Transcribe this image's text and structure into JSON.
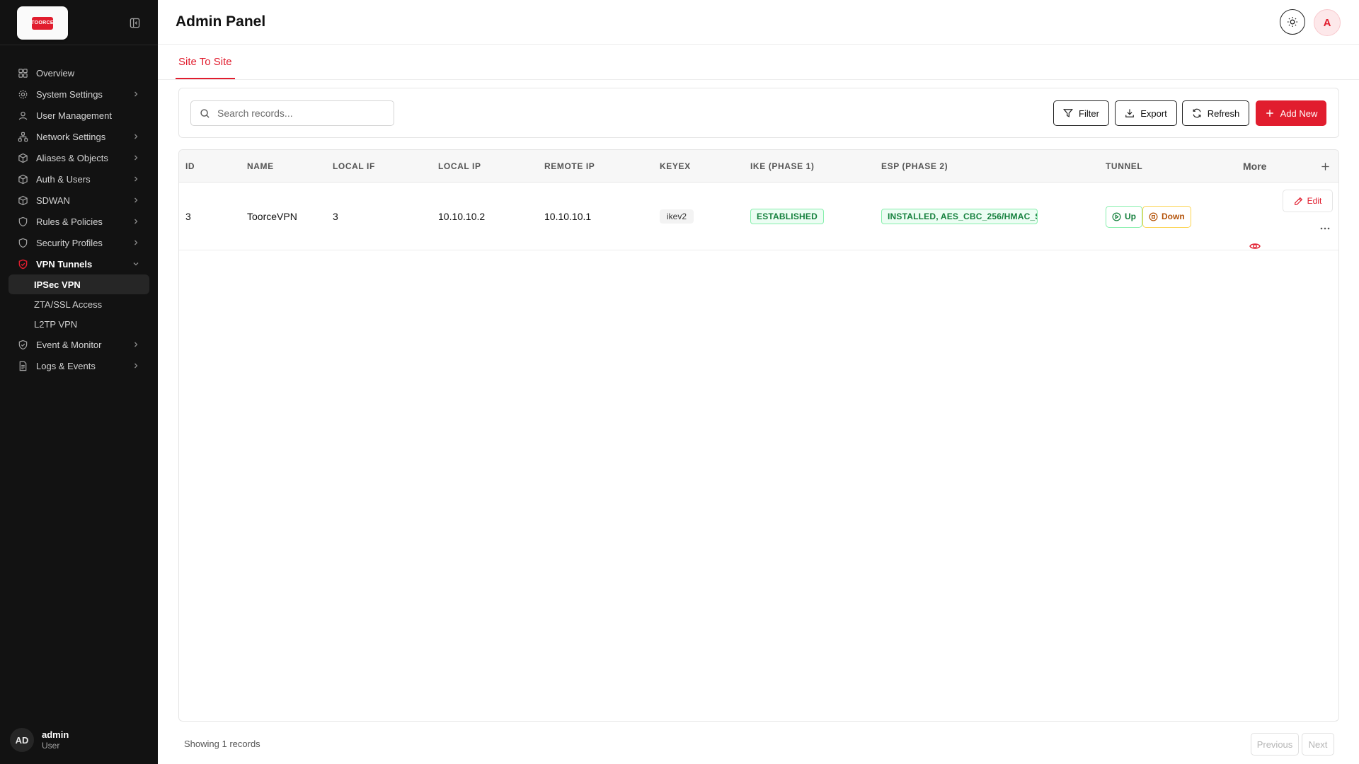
{
  "app": {
    "logo_text": "TOORCE",
    "page_title": "Admin Panel"
  },
  "sidebar": {
    "items": [
      {
        "label": "Overview",
        "icon": "grid-icon",
        "has_chevron": false
      },
      {
        "label": "System Settings",
        "icon": "gear-icon",
        "has_chevron": true
      },
      {
        "label": "User Management",
        "icon": "user-icon",
        "has_chevron": false
      },
      {
        "label": "Network Settings",
        "icon": "network-icon",
        "has_chevron": true
      },
      {
        "label": "Aliases & Objects",
        "icon": "cube-icon",
        "has_chevron": true
      },
      {
        "label": "Auth & Users",
        "icon": "cube-icon",
        "has_chevron": true
      },
      {
        "label": "SDWAN",
        "icon": "cube-icon",
        "has_chevron": true
      },
      {
        "label": "Rules & Policies",
        "icon": "shield-icon",
        "has_chevron": true
      },
      {
        "label": "Security Profiles",
        "icon": "shield-icon",
        "has_chevron": true
      },
      {
        "label": "VPN Tunnels",
        "icon": "shield-check-icon",
        "has_chevron": true,
        "expanded": true
      },
      {
        "label": "Event & Monitor",
        "icon": "shield-check-icon",
        "has_chevron": true
      },
      {
        "label": "Logs & Events",
        "icon": "document-icon",
        "has_chevron": true
      }
    ],
    "vpn_sub_items": [
      {
        "label": "IPSec VPN",
        "active": true
      },
      {
        "label": "ZTA/SSL Access",
        "active": false
      },
      {
        "label": "L2TP VPN",
        "active": false
      }
    ],
    "user": {
      "initials": "AD",
      "name": "admin",
      "role": "User"
    }
  },
  "header": {
    "avatar_initial": "A"
  },
  "tabs": [
    {
      "label": "Site To Site",
      "active": true
    }
  ],
  "toolbar": {
    "search_placeholder": "Search records...",
    "search_value": "",
    "filter_label": "Filter",
    "export_label": "Export",
    "refresh_label": "Refresh",
    "add_label": "Add New"
  },
  "table": {
    "columns": [
      "ID",
      "NAME",
      "LOCAL IF",
      "LOCAL IP",
      "REMOTE IP",
      "KEYEX",
      "IKE (PHASE 1)",
      "ESP (PHASE 2)",
      "TUNNEL",
      "More"
    ],
    "rows": [
      {
        "id": "3",
        "name": "ToorceVPN",
        "local_if": "3",
        "local_ip": "10.10.10.2",
        "remote_ip": "10.10.10.1",
        "keyex": "ikev2",
        "ike": "ESTABLISHED",
        "esp": "INSTALLED, AES_CBC_256/HMAC_S",
        "tunnel_up": "Up",
        "tunnel_down": "Down",
        "edit_label": "Edit"
      }
    ]
  },
  "footer": {
    "showing": "Showing 1 records",
    "previous": "Previous",
    "next": "Next"
  },
  "colors": {
    "accent": "#e11d2e",
    "sidebar_bg": "#121212",
    "success": "#15803d",
    "warning": "#b45309"
  }
}
